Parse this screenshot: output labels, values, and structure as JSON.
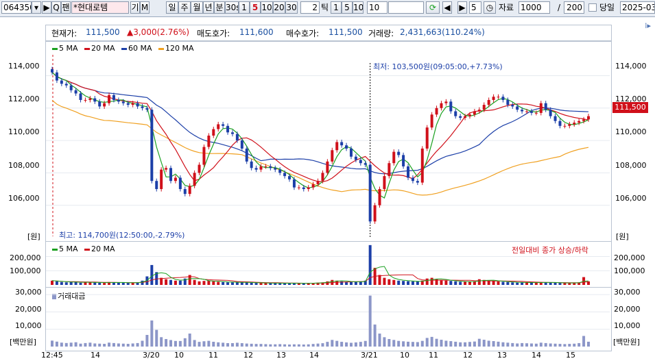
{
  "toolbar": {
    "code": "064350",
    "code_btn_label": "▾",
    "play_label": "▶",
    "search_label": "Q",
    "mode_label": "팬",
    "name": "*현대로템",
    "gi_label": "기",
    "m_label": "M",
    "periods": [
      "일",
      "주",
      "월",
      "년",
      "분",
      "30s",
      "1",
      "5",
      "10",
      "20",
      "30"
    ],
    "active_period": "5",
    "tick_value": "2",
    "tick_label": "틱",
    "tick_opts": [
      "1",
      "5",
      "10"
    ],
    "tick_input": "10",
    "step_value": "5",
    "data_label": "자료",
    "count_value": "1000",
    "page_slash": "/",
    "page_value": "200",
    "today_label": "당일",
    "date_value": "2025-03-"
  },
  "info": {
    "price_label": "현재가:",
    "price_value": "111,500",
    "change_value": "▲3,000(2.76%)",
    "ask_label": "매도호가:",
    "ask_value": "111,600",
    "bid_label": "매수호가:",
    "bid_value": "111,500",
    "volume_label": "거래량:",
    "volume_value": "2,431,663(110.24%)"
  },
  "price_panel": {
    "legend": [
      {
        "label": "5 MA",
        "color": "#1aa020"
      },
      {
        "label": "20 MA",
        "color": "#d0101a"
      },
      {
        "label": "60 MA",
        "color": "#1c3fa8"
      },
      {
        "label": "120 MA",
        "color": "#f0a020"
      }
    ],
    "y_ticks": [
      "114,000",
      "112,000",
      "110,000",
      "108,000",
      "106,000"
    ],
    "unit": "[원]",
    "current_price": "111,500",
    "low_annotation": "최저: 103,500원(09:05:00,+7.73%)",
    "high_annotation": "최고: 114,700원(12:50:00,-2.79%)"
  },
  "volume_panel": {
    "legend": [
      {
        "label": "5 MA",
        "color": "#1aa020"
      },
      {
        "label": "20 MA",
        "color": "#d0101a"
      }
    ],
    "y_ticks": [
      "200,000",
      "100,000"
    ],
    "note": "전일대비 종가 상승/하락"
  },
  "amount_panel": {
    "legend_label": "거래대금",
    "legend_color": "#8c96c8",
    "y_ticks": [
      "30,000",
      "20,000",
      "10,000"
    ],
    "unit": "[백만원]"
  },
  "x_axis": [
    "12:45",
    "14",
    "3/20",
    "10",
    "11",
    "12",
    "13",
    "14",
    "3/21",
    "10",
    "11",
    "12",
    "13",
    "14",
    "15"
  ],
  "colors": {
    "up": "#d0101a",
    "down": "#1c3fa8",
    "ma5": "#1aa020",
    "ma20": "#d0101a",
    "ma60": "#1c3fa8",
    "ma120": "#f0a020",
    "amount": "#8c96c8"
  },
  "chart_data": {
    "type": "candlestick",
    "note": "5-minute candles, values approximate (read from chart)",
    "ylim_price": [
      104000,
      115500
    ],
    "closes": [
      114200,
      113700,
      113500,
      113400,
      113100,
      112900,
      112500,
      112500,
      112600,
      112400,
      112100,
      112300,
      112800,
      112500,
      112400,
      112300,
      112200,
      112300,
      112100,
      112000,
      111900,
      107500,
      107000,
      108200,
      108300,
      107500,
      107700,
      107000,
      106700,
      107200,
      108000,
      108500,
      109600,
      110300,
      110700,
      111000,
      110900,
      110500,
      110400,
      110000,
      109500,
      108700,
      108300,
      108200,
      108400,
      108400,
      108300,
      108200,
      108000,
      107800,
      107600,
      107100,
      107100,
      107000,
      107100,
      107300,
      107500,
      108000,
      108700,
      109400,
      109900,
      109700,
      109500,
      109000,
      108800,
      108600,
      108500,
      105000,
      106000,
      107000,
      107800,
      108600,
      109300,
      109100,
      108400,
      107700,
      107500,
      107400,
      109500,
      110800,
      111600,
      112000,
      112300,
      112400,
      111800,
      111500,
      111400,
      111500,
      111600,
      111800,
      111900,
      112200,
      112500,
      112700,
      112700,
      112500,
      112200,
      112100,
      111900,
      111800,
      111800,
      111700,
      111700,
      112300,
      111900,
      111500,
      111200,
      110900,
      110900,
      111000,
      111100,
      111200,
      111300,
      111500
    ],
    "volume_ylim": [
      0,
      260000
    ],
    "volumes": [
      30000,
      25000,
      20000,
      18000,
      20000,
      22000,
      15000,
      18000,
      20000,
      16000,
      15000,
      14000,
      20000,
      18000,
      16000,
      15000,
      14000,
      16000,
      18000,
      30000,
      60000,
      140000,
      90000,
      50000,
      40000,
      35000,
      30000,
      30000,
      45000,
      70000,
      35000,
      25000,
      28000,
      30000,
      25000,
      22000,
      20000,
      18000,
      18000,
      20000,
      18000,
      16000,
      15000,
      14000,
      14000,
      13000,
      12000,
      12000,
      13000,
      12000,
      11000,
      12000,
      12000,
      11000,
      12000,
      14000,
      16000,
      18000,
      25000,
      35000,
      30000,
      25000,
      22000,
      20000,
      22000,
      25000,
      30000,
      280000,
      120000,
      70000,
      50000,
      40000,
      35000,
      30000,
      28000,
      26000,
      25000,
      24000,
      30000,
      45000,
      50000,
      40000,
      35000,
      30000,
      28000,
      25000,
      22000,
      22000,
      24000,
      26000,
      40000,
      35000,
      30000,
      28000,
      25000,
      22000,
      20000,
      18000,
      16000,
      18000,
      17000,
      16000,
      15000,
      20000,
      18000,
      16000,
      15000,
      14000,
      13000,
      14000,
      15000,
      18000,
      55000,
      25000
    ],
    "amount_ylim": [
      0,
      32000
    ]
  }
}
